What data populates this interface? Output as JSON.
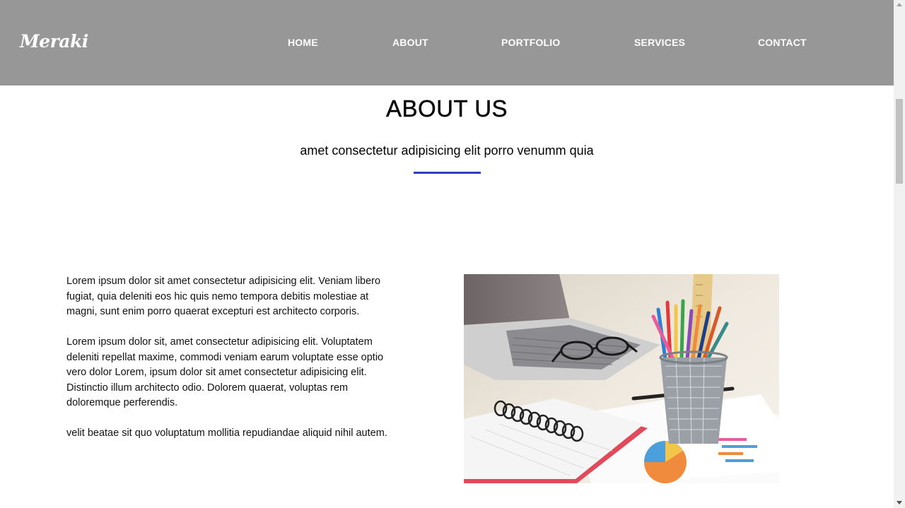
{
  "header": {
    "logo": "Meraki",
    "nav": [
      {
        "label": "HOME"
      },
      {
        "label": "ABOUT"
      },
      {
        "label": "PORTFOLIO"
      },
      {
        "label": "SERVICES"
      },
      {
        "label": "CONTACT"
      }
    ]
  },
  "about": {
    "title": "ABOUT US",
    "subtitle": "amet consectetur adipisicing elit porro venumm quia",
    "accent_color": "#2e3fbf",
    "paragraphs": [
      "Lorem ipsum dolor sit amet consectetur adipisicing elit. Veniam libero fugiat, quia deleniti eos hic quis nemo tempora debitis molestiae at magni, sunt enim porro quaerat excepturi est architecto corporis.",
      "Lorem ipsum dolor sit, amet consectetur adipisicing elit. Voluptatem deleniti repellat maxime, commodi veniam earum voluptate esse optio vero dolor Lorem, ipsum dolor sit amet consectetur adipisicing elit. Distinctio illum architecto odio. Dolorem quaerat, voluptas rem doloremque perferendis.",
      "velit beatae sit quo voluptatum mollitia repudiandae aliquid nihil autem."
    ]
  },
  "colors": {
    "navbar": "#979797",
    "nav_text": "#ffffff"
  }
}
